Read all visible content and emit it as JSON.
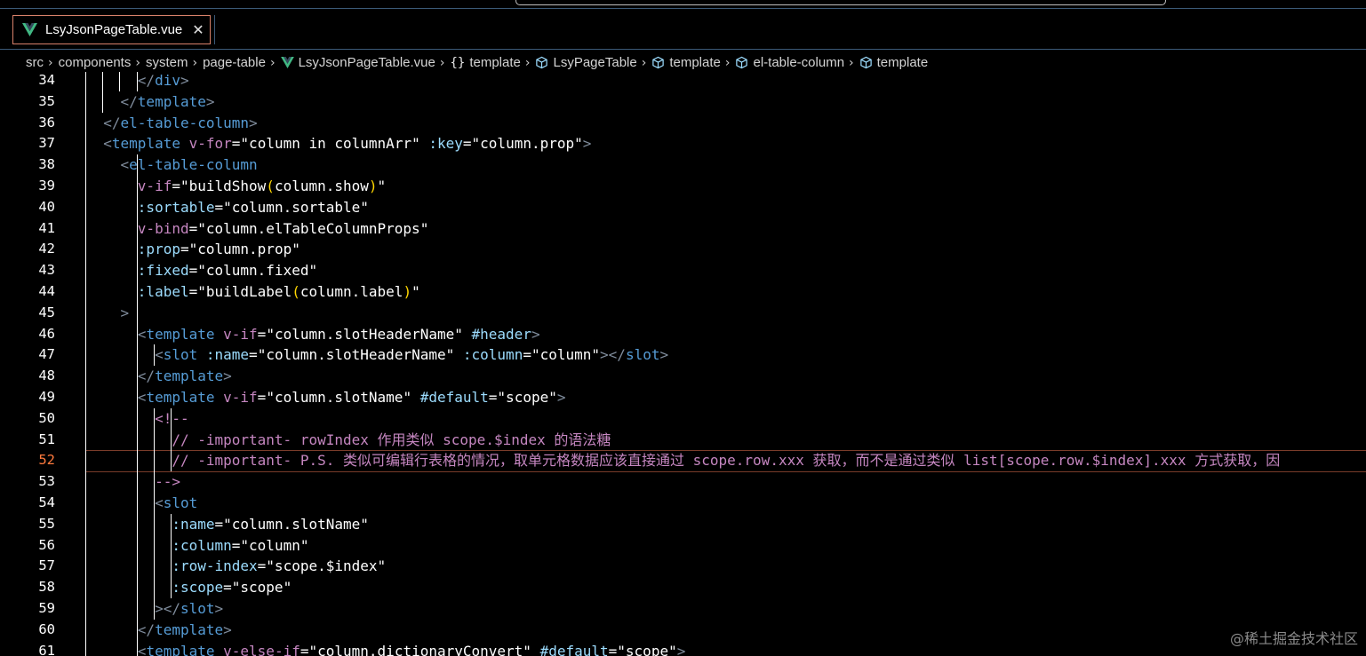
{
  "tab": {
    "label": "LsyJsonPageTable.vue",
    "close_glyph": "✕",
    "file_icon": "vue-icon"
  },
  "breadcrumb": [
    {
      "label": "src"
    },
    {
      "label": "components"
    },
    {
      "label": "system"
    },
    {
      "label": "page-table"
    },
    {
      "label": "LsyJsonPageTable.vue",
      "icon": "vue-icon"
    },
    {
      "label": "template",
      "icon": "braces-icon"
    },
    {
      "label": "LsyPageTable",
      "icon": "cube-icon"
    },
    {
      "label": "template",
      "icon": "cube-icon"
    },
    {
      "label": "el-table-column",
      "icon": "cube-icon"
    },
    {
      "label": "template",
      "icon": "cube-icon"
    }
  ],
  "editor": {
    "active_line": 52,
    "lines": [
      {
        "n": "34",
        "code": "    </div>"
      },
      {
        "n": "35",
        "code": "  </template>"
      },
      {
        "n": "36",
        "code": "</el-table-column>"
      },
      {
        "n": "37",
        "code": "<template v-for=\"column in columnArr\" :key=\"column.prop\">"
      },
      {
        "n": "38",
        "code": "  <el-table-column"
      },
      {
        "n": "39",
        "code": "    v-if=\"buildShow(column.show)\""
      },
      {
        "n": "40",
        "code": "    :sortable=\"column.sortable\""
      },
      {
        "n": "41",
        "code": "    v-bind=\"column.elTableColumnProps\""
      },
      {
        "n": "42",
        "code": "    :prop=\"column.prop\""
      },
      {
        "n": "43",
        "code": "    :fixed=\"column.fixed\""
      },
      {
        "n": "44",
        "code": "    :label=\"buildLabel(column.label)\""
      },
      {
        "n": "45",
        "code": "  >"
      },
      {
        "n": "46",
        "code": "    <template v-if=\"column.slotHeaderName\" #header>"
      },
      {
        "n": "47",
        "code": "      <slot :name=\"column.slotHeaderName\" :column=\"column\"></slot>"
      },
      {
        "n": "48",
        "code": "    </template>"
      },
      {
        "n": "49",
        "code": "    <template v-if=\"column.slotName\" #default=\"scope\">"
      },
      {
        "n": "50",
        "code": "      <!--"
      },
      {
        "n": "51",
        "code": "        // -important- rowIndex 作用类似 scope.$index 的语法糖"
      },
      {
        "n": "52",
        "code": "        // -important- P.S. 类似可编辑行表格的情况，取单元格数据应该直接通过 scope.row.xxx 获取，而不是通过类似 list[scope.row.$index].xxx 方式获取，因"
      },
      {
        "n": "53",
        "code": "      -->"
      },
      {
        "n": "54",
        "code": "      <slot"
      },
      {
        "n": "55",
        "code": "        :name=\"column.slotName\""
      },
      {
        "n": "56",
        "code": "        :column=\"column\""
      },
      {
        "n": "57",
        "code": "        :row-index=\"scope.$index\""
      },
      {
        "n": "58",
        "code": "        :scope=\"scope\""
      },
      {
        "n": "59",
        "code": "      ></slot>"
      },
      {
        "n": "60",
        "code": "    </template>"
      },
      {
        "n": "61",
        "code": "    <template v-else-if=\"column.dictionaryConvert\" #default=\"scope\">"
      }
    ]
  },
  "watermark": "@稀土掘金技术社区",
  "colors": {
    "background": "#000000",
    "tag": "#569cd6",
    "attribute": "#9cdcfe",
    "directive": "#c586c0",
    "bracket_gold": "#ffd700",
    "active_line_number": "#ff7a3d",
    "tab_border": "#d9816a",
    "vue_green": "#41b883"
  }
}
